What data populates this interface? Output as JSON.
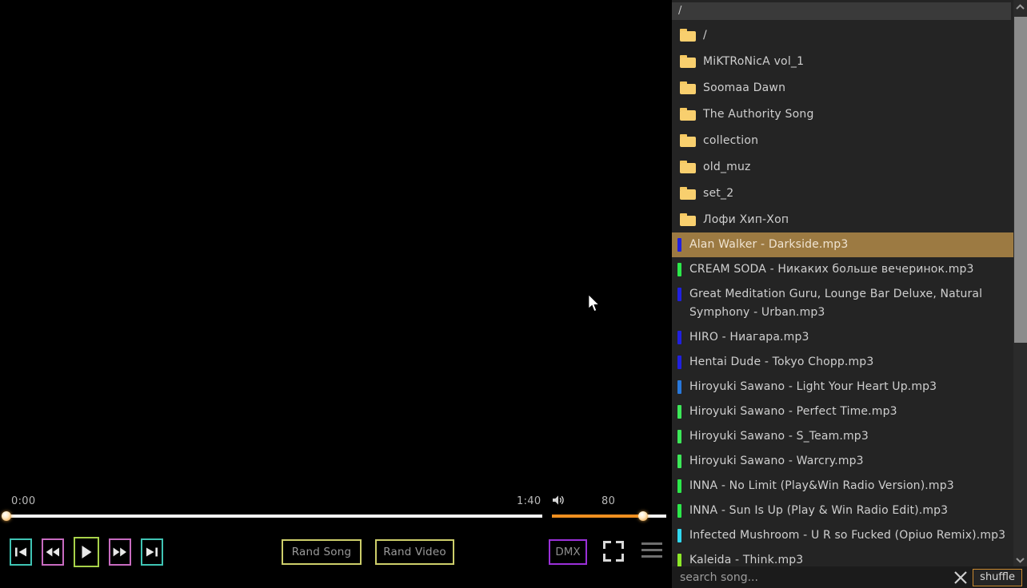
{
  "player": {
    "time_current": "0:00",
    "time_total": "1:40",
    "volume_value": "80",
    "volume_icon": "speaker-icon",
    "seek_percent": 0,
    "volume_percent": 80,
    "transport": [
      {
        "name": "skip-previous-button",
        "glyph": "prev-track-icon",
        "accent": "#3fc4b4"
      },
      {
        "name": "rewind-button",
        "glyph": "rewind-icon",
        "accent": "#c86bc0"
      },
      {
        "name": "play-button",
        "glyph": "play-icon",
        "accent": "#a8d24a"
      },
      {
        "name": "fast-forward-button",
        "glyph": "fast-forward-icon",
        "accent": "#c86bc0"
      },
      {
        "name": "skip-next-button",
        "glyph": "next-track-icon",
        "accent": "#3fc4b4"
      }
    ],
    "rand_song_label": "Rand Song",
    "rand_video_label": "Rand Video",
    "dmx_label": "DMX",
    "fullscreen_icon": "fullscreen-icon",
    "menu_icon": "hamburger-menu-icon"
  },
  "browser": {
    "breadcrumb": "/",
    "folders": [
      {
        "name": "/"
      },
      {
        "name": "MiKTRoNicA vol_1"
      },
      {
        "name": "Soomaa Dawn"
      },
      {
        "name": "The Authority Song"
      },
      {
        "name": "collection"
      },
      {
        "name": "old_muz"
      },
      {
        "name": "set_2"
      },
      {
        "name": "Лофи Хип-Хоп"
      }
    ],
    "songs": [
      {
        "title": "Alan Walker - Darkside.mp3",
        "color": "#2020e0",
        "selected": true
      },
      {
        "title": "CREAM SODA - Никаких больше вечеринок.mp3",
        "color": "#2ce84a",
        "selected": false
      },
      {
        "title": "Great Meditation Guru, Lounge Bar Deluxe, Natural Symphony - Urban.mp3",
        "color": "#2020e0",
        "selected": false
      },
      {
        "title": "HIRO - Ниагара.mp3",
        "color": "#2020e0",
        "selected": false
      },
      {
        "title": "Hentai Dude - Tokyo Chopp.mp3",
        "color": "#2020e0",
        "selected": false
      },
      {
        "title": "Hiroyuki Sawano - Light Your Heart Up.mp3",
        "color": "#2878dc",
        "selected": false
      },
      {
        "title": "Hiroyuki Sawano - Perfect Time.mp3",
        "color": "#3ce858",
        "selected": false
      },
      {
        "title": "Hiroyuki Sawano - S_Team.mp3",
        "color": "#3ce858",
        "selected": false
      },
      {
        "title": "Hiroyuki Sawano - Warcry.mp3",
        "color": "#3ce858",
        "selected": false
      },
      {
        "title": "INNA - No Limit (Play&Win Radio Version).mp3",
        "color": "#2ce84a",
        "selected": false
      },
      {
        "title": "INNA - Sun Is Up (Play & Win Radio Edit).mp3",
        "color": "#2ce84a",
        "selected": false
      },
      {
        "title": "Infected Mushroom - U R so Fucked (Opiuo Remix).mp3",
        "color": "#30d8f0",
        "selected": false
      },
      {
        "title": "Kaleida - Think.mp3",
        "color": "#8ce828",
        "selected": false
      }
    ],
    "search_placeholder": "search song...",
    "search_value": "",
    "clear_icon": "close-icon",
    "shuffle_label": "shuffle",
    "scroll_up_icon": "chevron-up-icon",
    "scroll_down_icon": "chevron-down-icon"
  }
}
